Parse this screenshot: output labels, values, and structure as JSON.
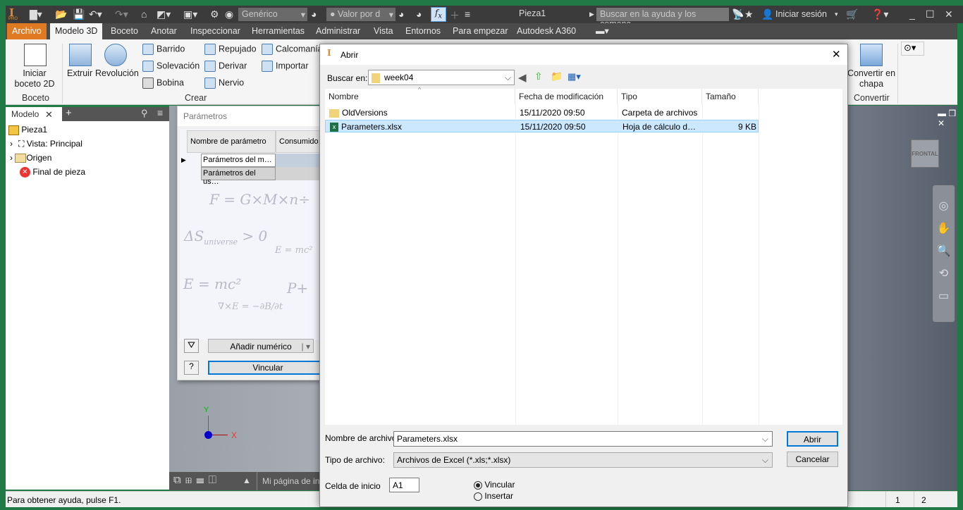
{
  "app": {
    "title": "Pieza1",
    "logo": "I",
    "logo_sub": "PRO",
    "material": "Genérico",
    "appearance": "Valor por d",
    "search_placeholder": "Buscar en la ayuda y los comanc",
    "signin": "Iniciar sesión"
  },
  "tabs": [
    "Archivo",
    "Modelo 3D",
    "Boceto",
    "Anotar",
    "Inspeccionar",
    "Herramientas",
    "Administrar",
    "Vista",
    "Entornos",
    "Para empezar",
    "Autodesk A360"
  ],
  "ribbon": {
    "sketch": "Iniciar boceto 2D",
    "sketch_l1": "Iniciar",
    "sketch_l2": "boceto 2D",
    "boceto_group": "Boceto",
    "extrude": "Extruir",
    "revolve": "Revolución",
    "sweep": "Barrido",
    "loft": "Solevación",
    "coil": "Bobina",
    "emboss": "Repujado",
    "derive": "Derivar",
    "rib": "Nervio",
    "decal": "Calcomanía",
    "import": "Importar",
    "crear_group": "Crear",
    "convert_l1": "Convertir en",
    "convert_l2": "chapa",
    "convert_group": "Convertir"
  },
  "browser": {
    "tab": "Modelo",
    "items": [
      "Pieza1",
      "Vista: Principal",
      "Origen",
      "Final de pieza"
    ]
  },
  "params": {
    "title": "Parámetros",
    "col1": "Nombre de parámetro",
    "col2": "Consumido p",
    "rows": [
      "Parámetros del m…",
      "Parámetros del us…"
    ],
    "add": "Añadir numérico",
    "link": "Vincular"
  },
  "viewcube": "FRONTAL",
  "viewport_tabs": {
    "page": "Mi página de in"
  },
  "axis": {
    "x": "X",
    "y": "Y"
  },
  "dialog": {
    "title": "Abrir",
    "look_in_label": "Buscar en:",
    "look_in": "week04",
    "columns": [
      "Nombre",
      "Fecha de modificación",
      "Tipo",
      "Tamaño"
    ],
    "files": [
      {
        "name": "OldVersions",
        "date": "15/11/2020 09:50",
        "type": "Carpeta de archivos",
        "size": ""
      },
      {
        "name": "Parameters.xlsx",
        "date": "15/11/2020 09:50",
        "type": "Hoja de cálculo d…",
        "size": "9 KB"
      }
    ],
    "filename_label": "Nombre de archivo:",
    "filename": "Parameters.xlsx",
    "filetype_label": "Tipo de archivo:",
    "filetype": "Archivos de Excel (*.xls;*.xlsx)",
    "open": "Abrir",
    "cancel": "Cancelar",
    "start_cell_label": "Celda de inicio",
    "start_cell": "A1",
    "link": "Vincular",
    "insert": "Insertar"
  },
  "status": {
    "text": "Para obtener ayuda, pulse F1.",
    "n1": "1",
    "n2": "2"
  }
}
